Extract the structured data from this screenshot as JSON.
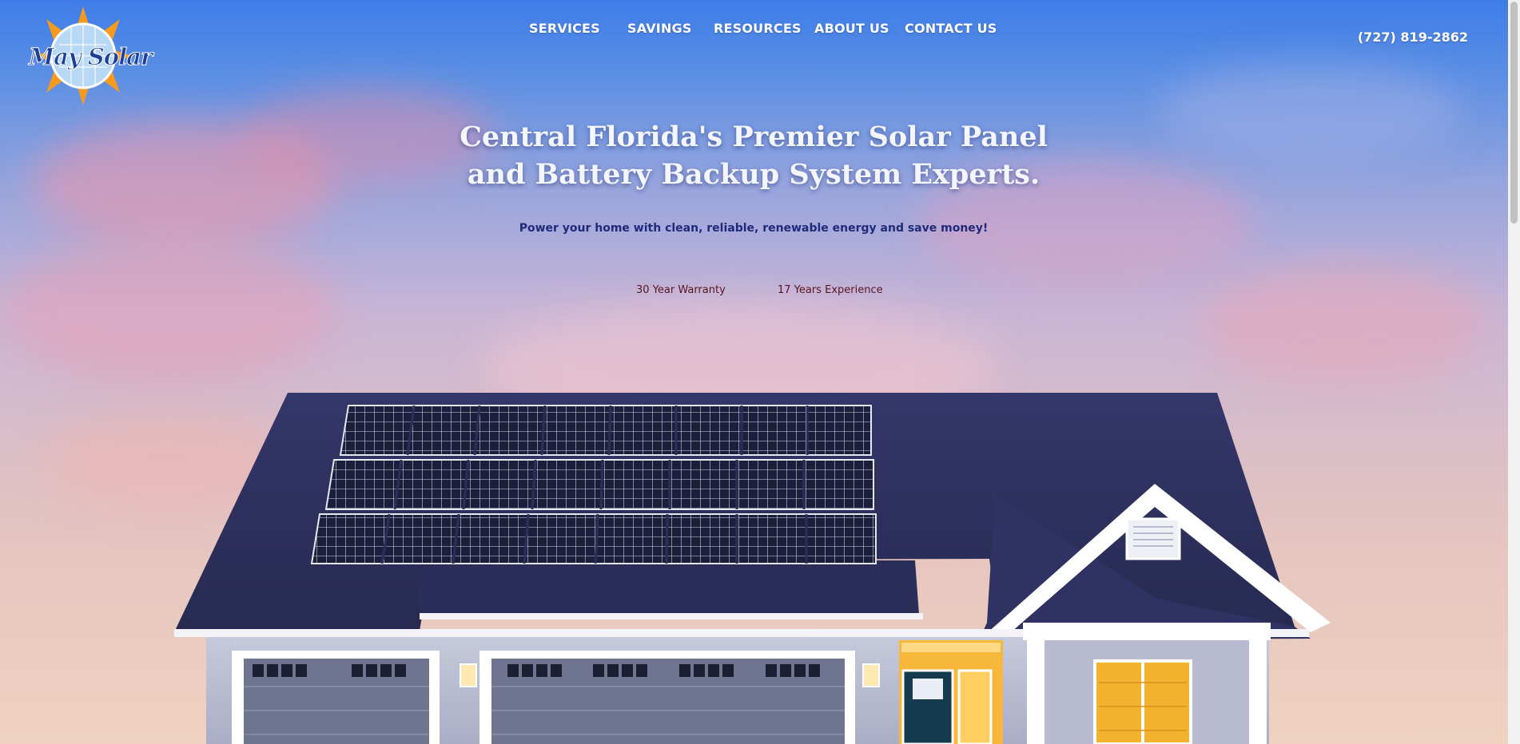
{
  "brand": {
    "logo_text": "May Solar"
  },
  "nav": [
    {
      "label": "SERVICES"
    },
    {
      "label": "SAVINGS"
    },
    {
      "label": "RESOURCES"
    },
    {
      "label": "ABOUT US"
    },
    {
      "label": "CONTACT US"
    }
  ],
  "phone": "(727) 819-2862",
  "hero": {
    "headline_line1": "Central Florida's Premier Solar Panel",
    "headline_line2": "and Battery Backup System Experts.",
    "subheadline": "Power your home with clean, reliable, renewable energy and save money!",
    "features": [
      "30 Year Warranty",
      "17 Years Experience"
    ]
  },
  "colors": {
    "sky_top": "#3d7ce8",
    "roof": "#2c2f5a",
    "headline_text": "#f4f6ff",
    "subheadline_text": "#1f2a7a",
    "feature_text": "#5a1420"
  }
}
